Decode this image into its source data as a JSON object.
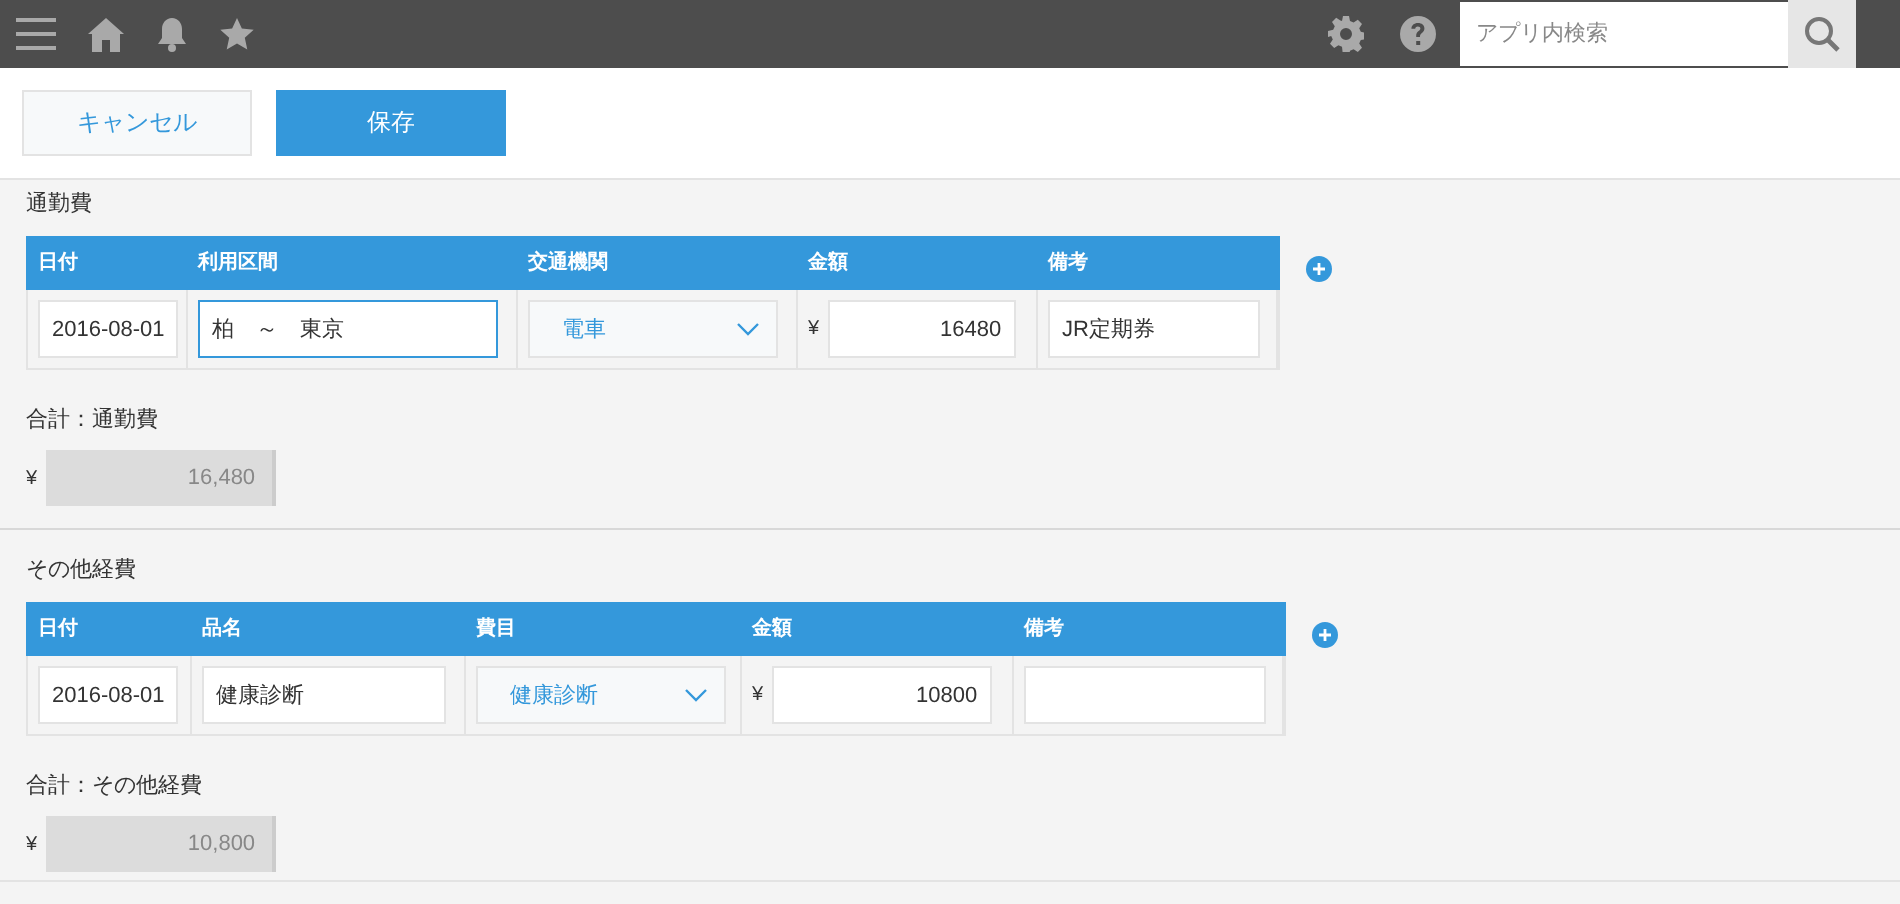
{
  "search": {
    "placeholder": "アプリ内検索"
  },
  "buttons": [
    {
      "label": "キャンセル",
      "kind": "secondary"
    },
    {
      "label": "保存",
      "kind": "primary"
    }
  ],
  "sections": [
    {
      "title": "通勤費",
      "columns": [
        "日付",
        "利用区間",
        "交通機関",
        "金額",
        "備考"
      ],
      "rows": [
        [
          {
            "kind": "text",
            "value": "2016-08-01",
            "focused": false
          },
          {
            "kind": "text",
            "value": "柏　～　東京",
            "focused": true
          },
          {
            "kind": "select",
            "value": "電車"
          },
          {
            "kind": "amount",
            "currency": "¥",
            "value": "16480",
            "focused": false
          },
          {
            "kind": "text",
            "value": "JR定期券",
            "focused": false
          }
        ]
      ],
      "total_label": "合計：通勤費",
      "total_currency": "¥",
      "total_value": "16,480"
    },
    {
      "title": "その他経費",
      "columns": [
        "日付",
        "品名",
        "費目",
        "金額",
        "備考"
      ],
      "rows": [
        [
          {
            "kind": "text",
            "value": "2016-08-01",
            "focused": false
          },
          {
            "kind": "text",
            "value": "健康診断",
            "focused": false
          },
          {
            "kind": "select",
            "value": "健康診断"
          },
          {
            "kind": "amount",
            "currency": "¥",
            "value": "10800",
            "focused": false
          },
          {
            "kind": "text",
            "focused": false
          }
        ]
      ],
      "total_label": "合計：その他経費",
      "total_currency": "¥",
      "total_value": "10,800"
    }
  ]
}
